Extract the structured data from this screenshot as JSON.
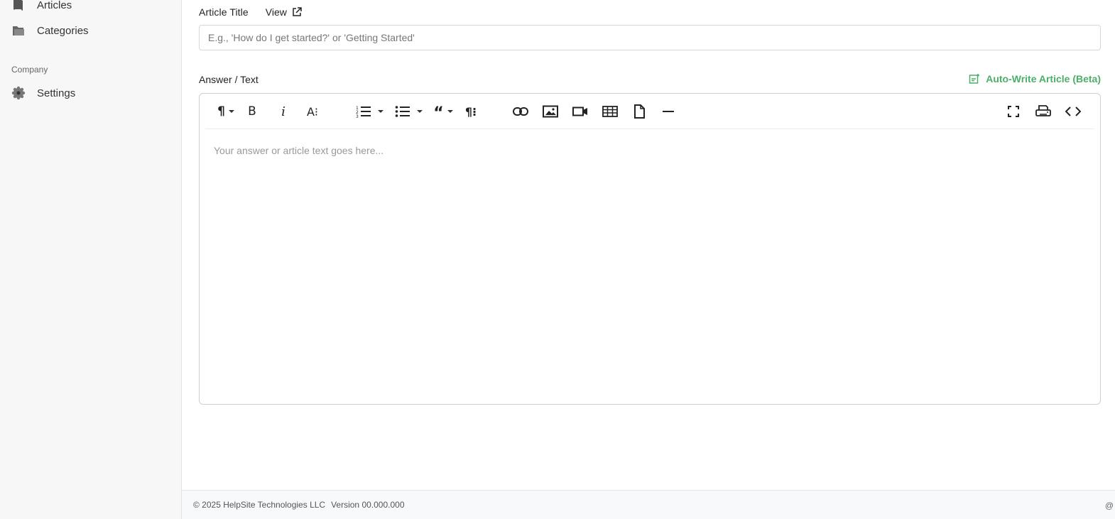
{
  "sidebar": {
    "items": [
      {
        "label": "Articles",
        "icon": "book-icon"
      },
      {
        "label": "Categories",
        "icon": "folder-icon"
      }
    ],
    "section_company": "Company",
    "settings_label": "Settings"
  },
  "form": {
    "title_label": "Article Title",
    "view_label": "View",
    "title_placeholder": "E.g., 'How do I get started?' or 'Getting Started'",
    "title_value": "",
    "answer_label": "Answer / Text",
    "autowrite_label": "Auto-Write Article (Beta)",
    "editor_placeholder": "Your answer or article text goes here..."
  },
  "toolbar_tools": [
    "paragraph-format",
    "bold",
    "italic",
    "font-size",
    "ordered-list",
    "unordered-list",
    "quote",
    "paragraph-style",
    "insert-link",
    "insert-image",
    "insert-video",
    "insert-table",
    "insert-file",
    "horizontal-line",
    "fullscreen",
    "print",
    "code-view"
  ],
  "footer": {
    "copyright": "© 2025 HelpSite Technologies LLC",
    "version": "Version 00.000.000",
    "trailing": "@"
  },
  "colors": {
    "accent_green": "#4caf68",
    "sidebar_bg": "#f7f7f7"
  }
}
